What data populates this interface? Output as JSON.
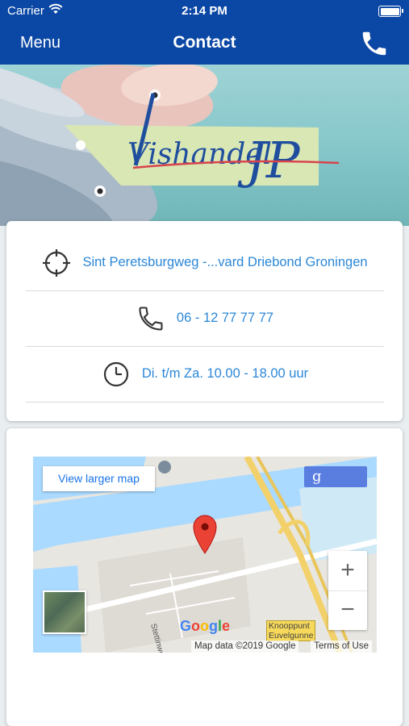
{
  "status_bar": {
    "carrier": "Carrier",
    "time": "2:14 PM"
  },
  "nav": {
    "menu_label": "Menu",
    "title": "Contact",
    "call_icon": "phone-icon"
  },
  "hero": {
    "logo_text_main": "Vishandel",
    "logo_text_initials": "JP"
  },
  "contact": {
    "address": "Sint Peretsburgweg -...vard Driebond Groningen",
    "address_icon": "crosshair-icon",
    "phone": "06 - 12 77 77 77",
    "phone_icon": "phone-icon",
    "hours": "Di. t/m Za. 10.00 - 18.00 uur",
    "hours_icon": "clock-icon"
  },
  "map": {
    "view_larger_label": "View larger map",
    "zoom_in_label": "+",
    "zoom_out_label": "−",
    "google_label": "Google",
    "copyright": "Map data ©2019 Google",
    "terms": "Terms of Use",
    "street_label": "Stettinweg",
    "junction_label": "Knooppunt",
    "junction_label_2": "Euvelgunne"
  },
  "colors": {
    "brand_blue": "#0b47a4",
    "link_blue": "#2b87d8",
    "pin_red": "#ea4335"
  }
}
